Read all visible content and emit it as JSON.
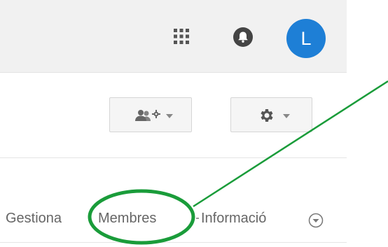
{
  "header": {
    "avatar_initial": "L",
    "avatar_color": "#1e7fd6",
    "icons": [
      "apps-icon",
      "notifications-bell-icon"
    ]
  },
  "toolbar": {
    "icons": [
      "members-settings-icon",
      "gear-icon",
      "caret-down-icon"
    ]
  },
  "tabs": [
    {
      "label": "Gestiona"
    },
    {
      "label": "Membres"
    },
    {
      "label": "Informació"
    }
  ],
  "annotation": {
    "color": "#1a9c3a",
    "shape": "ellipse-with-pointer-line"
  }
}
